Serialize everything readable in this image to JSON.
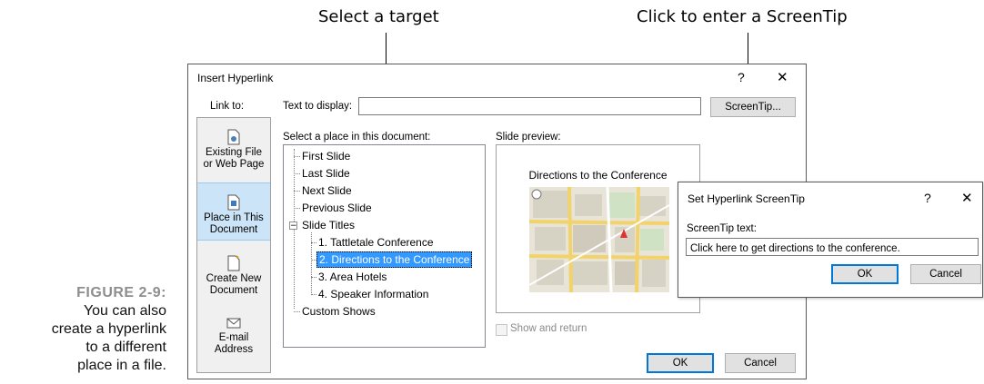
{
  "callouts": {
    "select_target": "Select a target",
    "screentip": "Click to enter a ScreenTip"
  },
  "figure": {
    "number": "FIGURE 2-9:",
    "caption_lines": [
      "You can also",
      "create a hyperlink",
      "to a different",
      "place in a file."
    ]
  },
  "main_dialog": {
    "title": "Insert Hyperlink",
    "help": "?",
    "close": "✕",
    "link_to_label": "Link to:",
    "text_to_display_label": "Text to display:",
    "text_to_display_value": "",
    "screentip_button": "ScreenTip...",
    "select_place_label": "Select a place in this document:",
    "slide_preview_label": "Slide preview:",
    "sidebar": [
      {
        "label_lines": [
          "Existing File",
          "or Web Page"
        ],
        "icon": "existing-file-icon"
      },
      {
        "label_lines": [
          "Place in This",
          "Document"
        ],
        "icon": "place-in-document-icon",
        "selected": true
      },
      {
        "label_lines": [
          "Create New",
          "Document"
        ],
        "icon": "new-document-icon"
      },
      {
        "label_lines": [
          "E-mail",
          "Address"
        ],
        "icon": "email-icon"
      }
    ],
    "tree": {
      "first": "First Slide",
      "last": "Last Slide",
      "next": "Next Slide",
      "previous": "Previous Slide",
      "titles": "Slide Titles",
      "slides": [
        "1. Tattletale Conference",
        "2. Directions to the Conference",
        "3. Area Hotels",
        "4. Speaker Information"
      ],
      "selected_index": 1,
      "custom": "Custom Shows"
    },
    "preview_title": "Directions to the Conference",
    "show_and_return": "Show and return",
    "ok": "OK",
    "cancel": "Cancel"
  },
  "screentip_dialog": {
    "title": "Set Hyperlink ScreenTip",
    "help": "?",
    "close": "✕",
    "label": "ScreenTip text:",
    "value": "Click here to get directions to the conference.",
    "ok": "OK",
    "cancel": "Cancel"
  },
  "colors": {
    "selection": "#3399ff",
    "sidebar_selected": "#cce4f7",
    "default_button_border": "#0078d7",
    "figure_number": "#8e8e8e"
  }
}
